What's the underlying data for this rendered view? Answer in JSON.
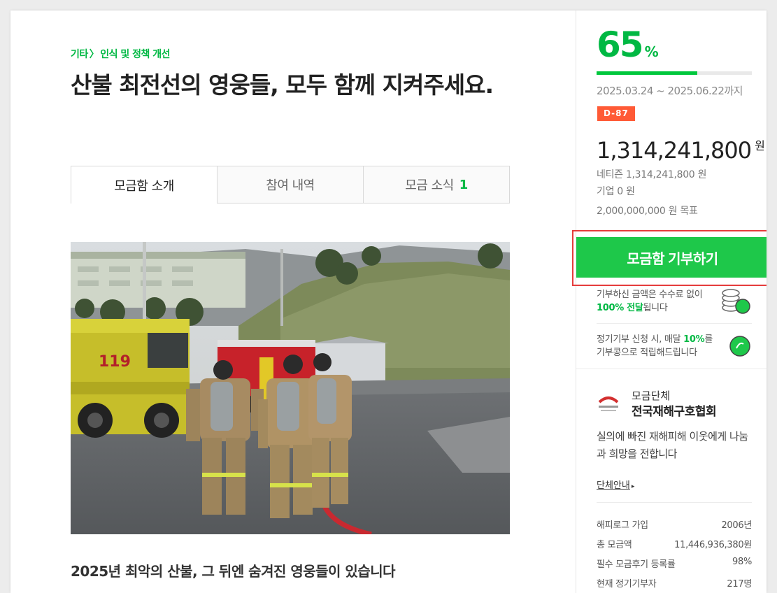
{
  "breadcrumb": {
    "category": "기타",
    "separator": "〉",
    "subcategory": "인식 및 정책 개선"
  },
  "title": "산불 최전선의 영웅들, 모두 함께 지켜주세요.",
  "tabs": [
    {
      "label": "모금함 소개",
      "count": ""
    },
    {
      "label": "참여 내역",
      "count": ""
    },
    {
      "label": "모금 소식",
      "count": "1"
    }
  ],
  "content": {
    "subheading": "2025년 최악의 산불, 그 뒤엔 숨겨진 영웅들이 있습니다"
  },
  "sidebar": {
    "progress_percent": "65",
    "percent_sign": "%",
    "progress_fraction": 0.65,
    "period": "2025.03.24 ~ 2025.06.22까지",
    "d_day": "D-87",
    "total_amount": "1,314,241,800",
    "currency": "원",
    "netizen": "네티즌 1,314,241,800 원",
    "company": "기업 0 원",
    "goal": "2,000,000,000 원 목표",
    "donate_button": "모금함 기부하기",
    "info1": {
      "line1": "기부하신 금액은 수수료 없이",
      "highlight": "100% 전달",
      "rest": "됩니다"
    },
    "info2": {
      "pre": "정기기부 신청 시, 매달 ",
      "highlight": "10%",
      "post": "를",
      "line2": "기부콩으로 적립해드립니다"
    },
    "org": {
      "label": "모금단체",
      "name": "전국재해구호협회",
      "description": "실의에 빠진 재해피해 이웃에게 나눔과 희망을 전합니다",
      "link": "단체안내",
      "link_arrow": "▸"
    },
    "stats": [
      {
        "label": "해피로그 가입",
        "value": "2006년"
      },
      {
        "label": "총 모금액",
        "value": "11,446,936,380원"
      },
      {
        "label": "필수 모금후기 등록률",
        "value": "98%"
      },
      {
        "label": "현재 정기기부자",
        "value": "217명"
      }
    ]
  },
  "colors": {
    "accent": "#00b843",
    "button": "#1ec84a",
    "dday": "#ff5a36",
    "highlight_border": "#e53c3c"
  }
}
